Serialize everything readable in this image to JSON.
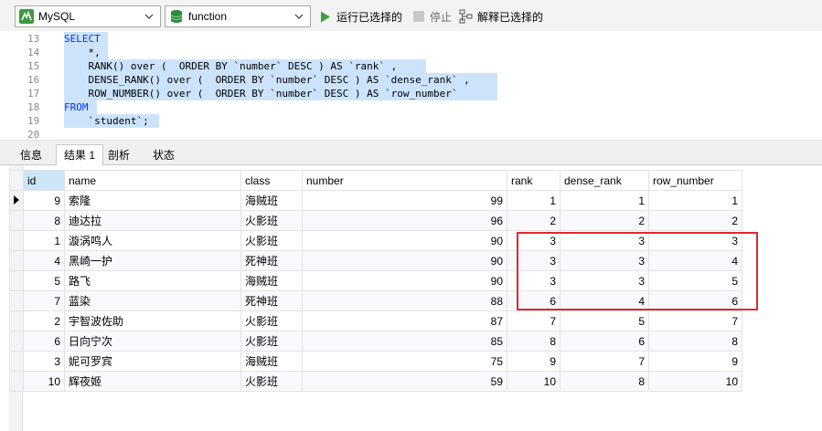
{
  "toolbar": {
    "db_select": "MySQL",
    "schema_select": "function",
    "run_selected": "运行已选择的",
    "stop": "停止",
    "explain_selected": "解释已选择的"
  },
  "editor": {
    "lines": [
      {
        "n": "13",
        "text": "SELECT"
      },
      {
        "n": "14",
        "text": "    *,"
      },
      {
        "n": "15",
        "text": "    RANK() over (  ORDER BY `number` DESC ) AS `rank` ,"
      },
      {
        "n": "16",
        "text": "    DENSE_RANK() over (  ORDER BY `number` DESC ) AS `dense_rank` ,"
      },
      {
        "n": "17",
        "text": "    ROW_NUMBER() over (  ORDER BY `number` DESC ) AS `row_number`"
      },
      {
        "n": "18",
        "text": "FROM"
      },
      {
        "n": "19",
        "text": "    `student`;"
      },
      {
        "n": "20",
        "text": ""
      }
    ]
  },
  "tabs": [
    "信息",
    "结果 1",
    "剖析",
    "状态"
  ],
  "active_tab": "结果 1",
  "grid": {
    "columns": [
      "id",
      "name",
      "class",
      "number",
      "rank",
      "dense_rank",
      "row_number"
    ],
    "rows": [
      [
        "9",
        "索隆",
        "海贼班",
        "99",
        "1",
        "1",
        "1"
      ],
      [
        "8",
        "迪达拉",
        "火影班",
        "96",
        "2",
        "2",
        "2"
      ],
      [
        "1",
        "漩涡鸣人",
        "火影班",
        "90",
        "3",
        "3",
        "3"
      ],
      [
        "4",
        "黑崎一护",
        "死神班",
        "90",
        "3",
        "3",
        "4"
      ],
      [
        "5",
        "路飞",
        "海贼班",
        "90",
        "3",
        "3",
        "5"
      ],
      [
        "7",
        "蓝染",
        "死神班",
        "88",
        "6",
        "4",
        "6"
      ],
      [
        "2",
        "宇智波佐助",
        "火影班",
        "87",
        "7",
        "5",
        "7"
      ],
      [
        "6",
        "日向宁次",
        "火影班",
        "85",
        "8",
        "6",
        "8"
      ],
      [
        "3",
        "妮可罗宾",
        "海贼班",
        "75",
        "9",
        "7",
        "9"
      ],
      [
        "10",
        "辉夜姬",
        "火影班",
        "59",
        "10",
        "8",
        "10"
      ]
    ]
  },
  "colors": {
    "highlight": "#cce3fb",
    "keyword": "#0033ff",
    "annotation_box": "#e0282e"
  }
}
